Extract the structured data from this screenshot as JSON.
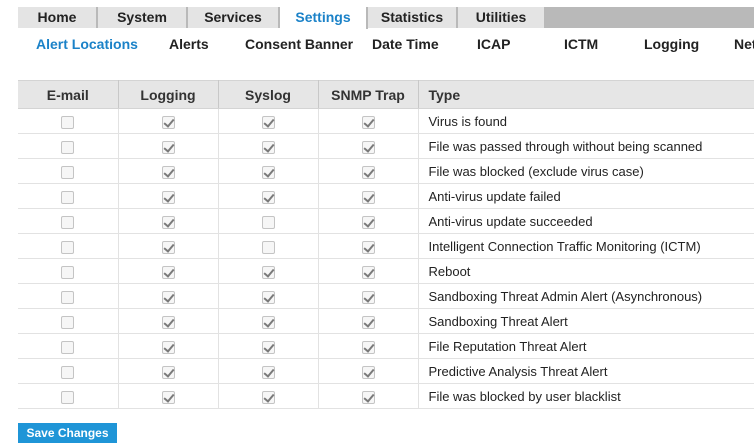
{
  "topTabs": [
    {
      "label": "Home"
    },
    {
      "label": "System"
    },
    {
      "label": "Services"
    },
    {
      "label": "Settings",
      "active": true
    },
    {
      "label": "Statistics"
    },
    {
      "label": "Utilities"
    }
  ],
  "subNav": [
    {
      "label": "Alert Locations",
      "active": true
    },
    {
      "label": "Alerts"
    },
    {
      "label": "Consent Banner"
    },
    {
      "label": "Date Time"
    },
    {
      "label": "ICAP"
    },
    {
      "label": "ICTM"
    },
    {
      "label": "Logging"
    },
    {
      "label": "Net"
    }
  ],
  "table": {
    "headers": {
      "email": "E-mail",
      "logging": "Logging",
      "syslog": "Syslog",
      "snmp": "SNMP Trap",
      "type": "Type"
    },
    "rows": [
      {
        "email": false,
        "logging": true,
        "syslog": true,
        "snmp": true,
        "type": "Virus is found"
      },
      {
        "email": false,
        "logging": true,
        "syslog": true,
        "snmp": true,
        "type": "File was passed through without being scanned"
      },
      {
        "email": false,
        "logging": true,
        "syslog": true,
        "snmp": true,
        "type": "File was blocked (exclude virus case)"
      },
      {
        "email": false,
        "logging": true,
        "syslog": true,
        "snmp": true,
        "type": "Anti-virus update failed"
      },
      {
        "email": false,
        "logging": true,
        "syslog": false,
        "snmp": true,
        "type": "Anti-virus update succeeded"
      },
      {
        "email": false,
        "logging": true,
        "syslog": false,
        "snmp": true,
        "type": "Intelligent Connection Traffic Monitoring (ICTM)"
      },
      {
        "email": false,
        "logging": true,
        "syslog": true,
        "snmp": true,
        "type": "Reboot"
      },
      {
        "email": false,
        "logging": true,
        "syslog": true,
        "snmp": true,
        "type": "Sandboxing Threat Admin Alert (Asynchronous)"
      },
      {
        "email": false,
        "logging": true,
        "syslog": true,
        "snmp": true,
        "type": "Sandboxing Threat Alert"
      },
      {
        "email": false,
        "logging": true,
        "syslog": true,
        "snmp": true,
        "type": "File Reputation Threat Alert"
      },
      {
        "email": false,
        "logging": true,
        "syslog": true,
        "snmp": true,
        "type": "Predictive Analysis Threat Alert"
      },
      {
        "email": false,
        "logging": true,
        "syslog": true,
        "snmp": true,
        "type": "File was blocked by user blacklist"
      }
    ]
  },
  "saveButton": {
    "label": "Save Changes"
  }
}
